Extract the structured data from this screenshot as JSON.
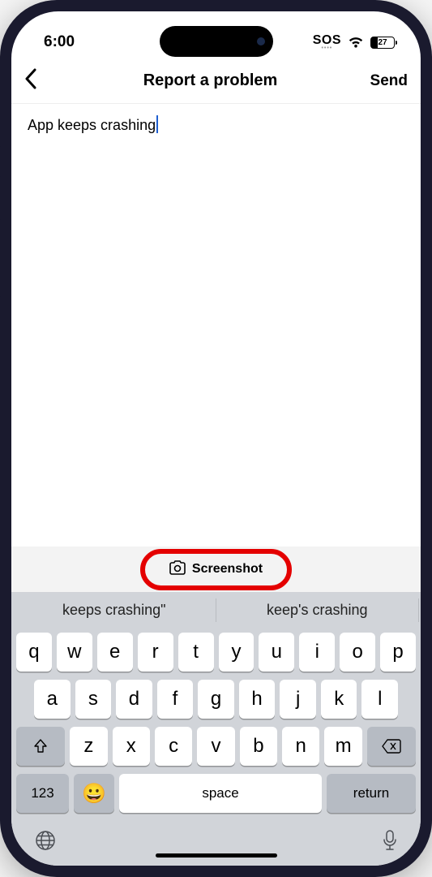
{
  "status": {
    "time": "6:00",
    "sos": "SOS",
    "battery": "27"
  },
  "nav": {
    "title": "Report a problem",
    "send": "Send"
  },
  "input": {
    "text": "App keeps crashing"
  },
  "screenshot": {
    "label": "Screenshot"
  },
  "suggestions": [
    "keeps crashing\"",
    "keep's crashing"
  ],
  "keys": {
    "row1": [
      "q",
      "w",
      "e",
      "r",
      "t",
      "y",
      "u",
      "i",
      "o",
      "p"
    ],
    "row2": [
      "a",
      "s",
      "d",
      "f",
      "g",
      "h",
      "j",
      "k",
      "l"
    ],
    "row3": [
      "z",
      "x",
      "c",
      "v",
      "b",
      "n",
      "m"
    ],
    "numbers": "123",
    "space": "space",
    "return": "return"
  }
}
